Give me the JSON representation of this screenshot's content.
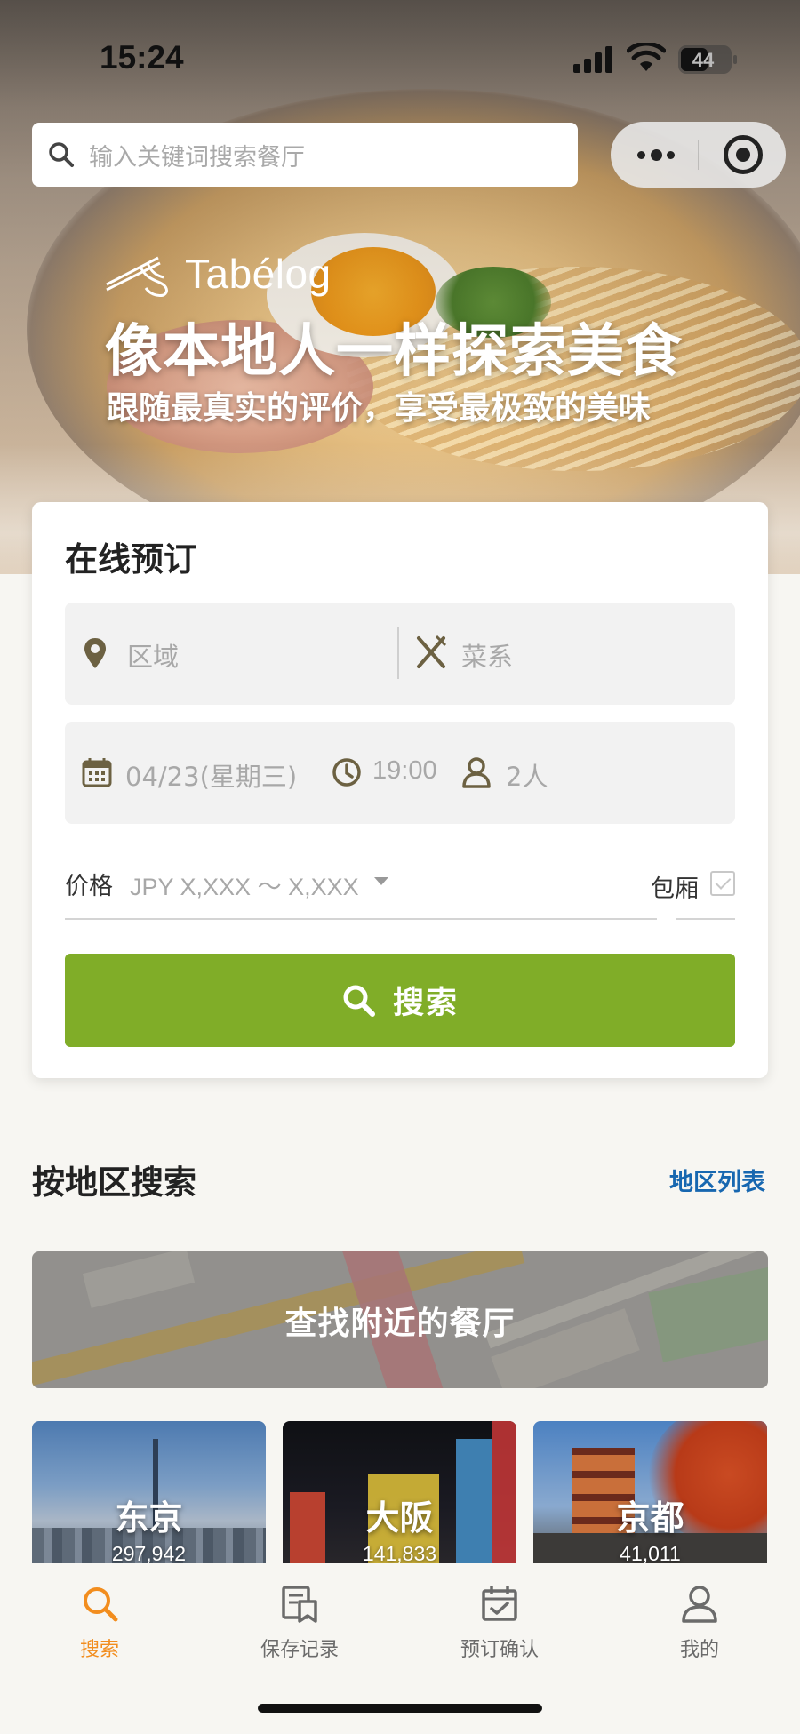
{
  "status_bar": {
    "time": "15:24",
    "battery": "44"
  },
  "search": {
    "placeholder": "输入关键词搜索餐厅"
  },
  "hero": {
    "brand": "Tabélog",
    "title": "像本地人一样探索美食",
    "subtitle": "跟随最真实的评价，享受最极致的美味"
  },
  "booking": {
    "title": "在线预订",
    "area_placeholder": "区域",
    "cuisine_placeholder": "菜系",
    "date": "04/23(星期三)",
    "time": "19:00",
    "people": "2人",
    "price_label": "价格",
    "price_value": "JPY X,XXX ～ X,XXX",
    "private_room_label": "包厢",
    "search_button": "搜索"
  },
  "region": {
    "title": "按地区搜索",
    "link": "地区列表",
    "nearby": "查找附近的餐厅",
    "cities": [
      {
        "name": "东京",
        "count": "297,942"
      },
      {
        "name": "大阪",
        "count": "141,833"
      },
      {
        "name": "京都",
        "count": "41,011"
      }
    ]
  },
  "tabbar": {
    "items": [
      {
        "label": "搜索",
        "icon": "search-icon",
        "active": true
      },
      {
        "label": "保存记录",
        "icon": "saved-records-icon",
        "active": false
      },
      {
        "label": "预订确认",
        "icon": "calendar-check-icon",
        "active": false
      },
      {
        "label": "我的",
        "icon": "user-icon",
        "active": false
      }
    ]
  },
  "colors": {
    "accent_green": "#80ad28",
    "link_blue": "#1767b0",
    "tab_active": "#f28d1e"
  }
}
